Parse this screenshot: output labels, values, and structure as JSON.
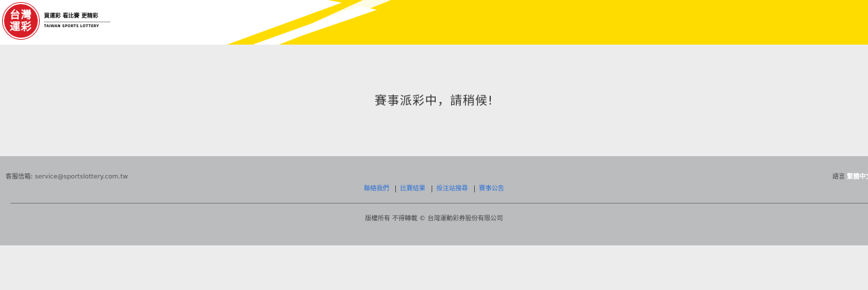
{
  "header": {
    "logo_line1": "台灣",
    "logo_line2": "運彩",
    "slogan": "買運彩 看比賽 更精彩",
    "brand_en": "TAIWAN SPORTS LOTTERY"
  },
  "main": {
    "message": "賽事派彩中，請稍候!"
  },
  "footer": {
    "contact_label": "客服信箱:",
    "contact_email": "service@sportslottery.com.tw",
    "language_label": "語言",
    "language_value": "繁體中文",
    "links": [
      "聯絡我們",
      "比賽結果",
      "投注站搜尋",
      "賽事公告"
    ],
    "copyright": "版權所有 不得轉載 © 台灣運動彩券股份有限公司"
  },
  "colors": {
    "brand_red": "#d81e27",
    "brand_yellow": "#ffdc00",
    "link_blue": "#2a6fd6",
    "footer_gray": "#bbbcbe",
    "page_bg": "#ececec"
  }
}
